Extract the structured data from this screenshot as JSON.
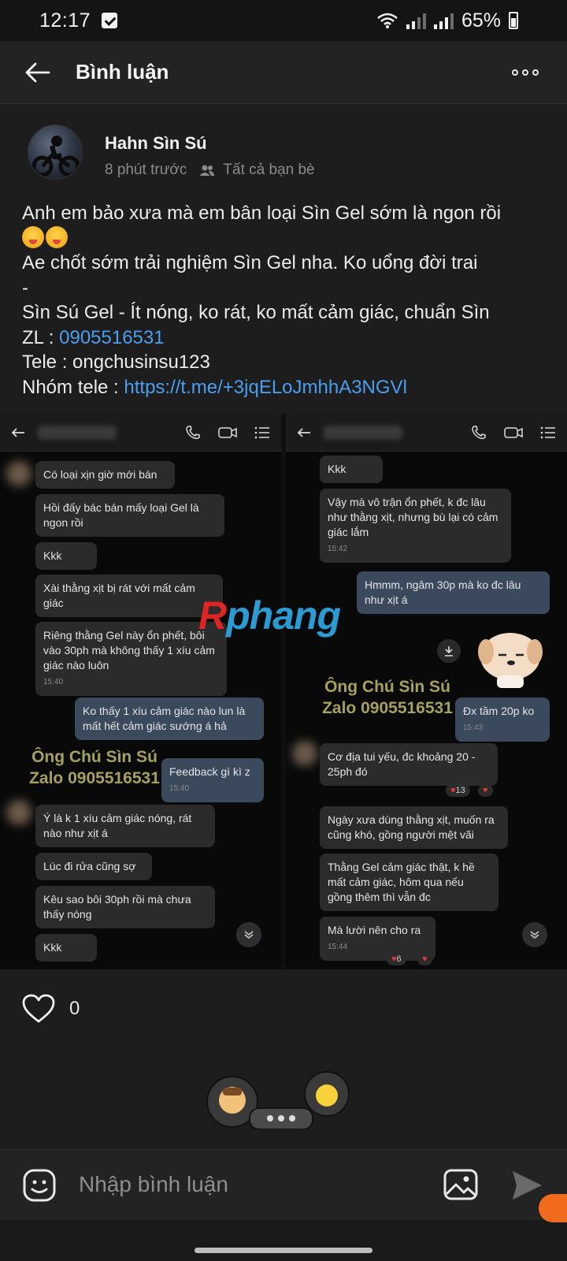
{
  "status_bar": {
    "time": "12:17",
    "battery": "65%"
  },
  "header": {
    "title": "Bình luận"
  },
  "post": {
    "author": "Hahn Sìn Sú",
    "time_ago": "8 phút trước",
    "audience": "Tất cả bạn bè",
    "lines": {
      "l1": "Anh em bảo xưa mà em bân loại Sìn Gel sớm là ngon rồi",
      "l3": "Ae chốt sớm trải nghiệm Sìn Gel nha. Ko uổng đời trai",
      "l4": "-",
      "l5": "Sìn Sú Gel - Ít nóng, ko rát, ko mất cảm giác, chuẩn Sìn",
      "zl_prefix": "ZL : ",
      "zl_link": "0905516531",
      "tele": "Tele : ongchusinsu123",
      "group_prefix": "Nhóm tele : ",
      "group_link": "https://t.me/+3jqELoJmhhA3NGVl"
    }
  },
  "screenshot_left": {
    "messages": [
      "Có loại xịn giờ mới bán",
      "Hồi đấy bác bán mấy loại Gel là ngon rồi",
      "Kkk",
      "Xài thằng xịt bị rát với mất cảm giác",
      "Riêng thằng Gel này ổn phết, bôi vào 30ph mà không thấy 1 xíu cảm giác nào luôn",
      "Ko thấy 1 xíu cảm giác nào lun là mất hết cảm giác sướng á hả",
      "Feedback gì kì z",
      "Ý là k 1 xíu cảm giác nóng, rát nào như xịt á",
      "Lúc đi rửa cũng sợ",
      "Kêu sao bôi 30ph rồi mà chưa thấy nóng",
      "Kkk"
    ],
    "ts1": "15:40",
    "ts2": "15:40",
    "watermark1": "Ông Chú Sìn Sú",
    "watermark2": "Zalo 0905516531"
  },
  "screenshot_right": {
    "messages": [
      "Kkk",
      "Vậy mà vô trận ổn phết, k đc lâu như thằng xịt, nhưng bù lại có cảm giác lắm",
      "Hmmm, ngâm 30p mà ko đc lâu như xịt á",
      "Đx tầm 20p ko",
      "Cơ địa tui yếu, đc khoảng 20 - 25ph đó",
      "Ngày xưa dùng thằng xịt, muốn ra cũng khó, gồng người mệt vãi",
      "Thằng Gel cảm giác thật, k hề mất cảm giác, hôm qua nếu gồng thêm thì vẫn đc",
      "Mà lười nên cho ra"
    ],
    "ts1": "15:42",
    "ts2": "15:43",
    "ts3": "15:44",
    "reaction1": "13",
    "reaction2": "6",
    "watermark1": "Ông Chú Sìn Sú",
    "watermark2": "Zalo 0905516531"
  },
  "watermark_logo": {
    "part1": "R",
    "part2": "phang"
  },
  "likes": {
    "count": "0"
  },
  "comment": {
    "placeholder": "Nhập bình luận"
  },
  "colors": {
    "link": "#4a9ff0",
    "heart": "#e53935",
    "accent_orange": "#f26a1b"
  }
}
